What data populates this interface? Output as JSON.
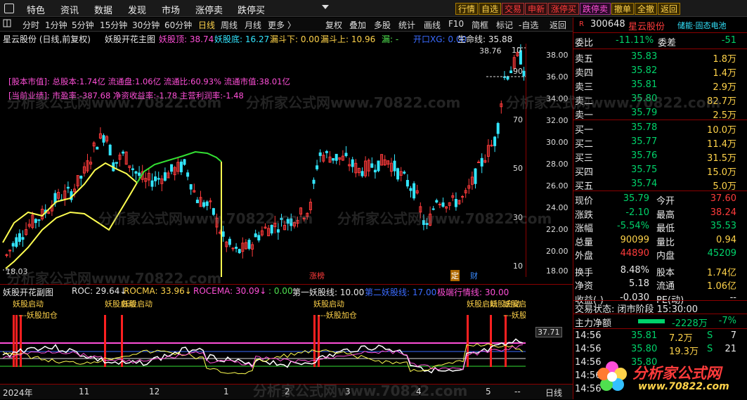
{
  "menu": [
    "特色",
    "资讯",
    "数据",
    "发现",
    "市场",
    "涨停卖",
    "跌停买"
  ],
  "toolbar_buttons": [
    {
      "label": "行情",
      "style": "yellow"
    },
    {
      "label": "自选",
      "style": "yellow"
    },
    {
      "label": "交易",
      "style": "red"
    },
    {
      "label": "申新",
      "style": "red"
    },
    {
      "label": "涨停买",
      "style": "red"
    },
    {
      "label": "跌停卖",
      "style": "mag"
    },
    {
      "label": "撤单",
      "style": "yellow"
    },
    {
      "label": "全撤",
      "style": "yellow"
    },
    {
      "label": "返回",
      "style": "yellow"
    }
  ],
  "period_tabs": [
    "分时",
    "1分钟",
    "5分钟",
    "15分钟",
    "30分钟",
    "60分钟",
    "日线",
    "周线",
    "月线",
    "更多 〉"
  ],
  "active_tab": "日线",
  "tools": [
    "复权",
    "叠加",
    "多股",
    "统计",
    "画线",
    "F10",
    "简框",
    "标记",
    "-自选",
    "返回"
  ],
  "main_indicator": {
    "stock_label": "星云股份 (日线,前复权)",
    "name": "妖股开花主图",
    "params": [
      "妖股顶: 38.74",
      "妖股底: 16.27",
      "漏斗下: 0.00",
      "漏斗上: 10.96",
      "漏: -",
      "开口XG: 0.00",
      "生命线: 35.88"
    ]
  },
  "info_box": {
    "line1": "[股本市值]:   总股本:1.74亿  流通盘:1.06亿  流通比:60.93%  流通市值:38.01亿",
    "line2": "[当前业绩]:   市盈率:-387.68  净资收益率:-1.78  主营利润率:-1.48"
  },
  "price_axis": [
    "38.00",
    "36.00",
    "34.00",
    "32.00",
    "30.00",
    "28.00",
    "26.00",
    "24.00",
    "22.00",
    "20.00",
    "18.00"
  ],
  "inner_axis": [
    "10",
    "90",
    "70",
    "50",
    "30",
    "10"
  ],
  "price_marks": {
    "high": "38.76",
    "low": "18.03"
  },
  "event_labels": [
    "涨榜",
    "定",
    "财"
  ],
  "sub_indicator": {
    "name": "妖股开花副图",
    "params": [
      "ROC: 29.64↓",
      "ROCMA: 33.96↓",
      "ROCEMA: 30.09↓",
      ": 0.00",
      "第一妖股线: 10.00",
      "第二妖股线: 17.00",
      "极端行情线: 30.00"
    ]
  },
  "sub_labels": [
    "妖股启动",
    "---妖股加仓",
    "妖股启动",
    "妖股启动",
    "妖股启动",
    "---妖股加仓",
    "妖股启动",
    "妖股启动",
    "妖股启动",
    "---妖股加"
  ],
  "sub_axis_value": "37.71",
  "dates": [
    "2024年",
    "11",
    "12",
    "1",
    "2",
    "3",
    "4",
    "5",
    "--",
    "日线"
  ],
  "quote": {
    "code": "300648",
    "name": "星云股份",
    "tags": "储能·固态电池",
    "weibi_label": "委比",
    "weibi": "-11.11%",
    "weicha_label": "委差",
    "weicha": "-51",
    "asks": [
      {
        "label": "卖五",
        "price": "35.83",
        "vol": "1.8万"
      },
      {
        "label": "卖四",
        "price": "35.82",
        "vol": "1.4万"
      },
      {
        "label": "卖三",
        "price": "35.81",
        "vol": "2.9万"
      },
      {
        "label": "卖二",
        "price": "35.80",
        "vol": "82.7万"
      },
      {
        "label": "卖一",
        "price": "35.79",
        "vol": "2.5万"
      }
    ],
    "bids": [
      {
        "label": "买一",
        "price": "35.78",
        "vol": "10.0万"
      },
      {
        "label": "买二",
        "price": "35.77",
        "vol": "11.4万"
      },
      {
        "label": "买三",
        "price": "35.76",
        "vol": "31.5万"
      },
      {
        "label": "买四",
        "price": "35.75",
        "vol": "15.0万"
      },
      {
        "label": "买五",
        "price": "35.74",
        "vol": "5.0万"
      }
    ],
    "stats": [
      {
        "l1": "现价",
        "v1": "35.79",
        "l2": "今开",
        "v2": "37.60"
      },
      {
        "l1": "涨跌",
        "v1": "-2.10",
        "l2": "最高",
        "v2": "38.24"
      },
      {
        "l1": "涨幅",
        "v1": "-5.54%",
        "l2": "最低",
        "v2": "35.53"
      },
      {
        "l1": "总量",
        "v1": "90099",
        "l2": "量比",
        "v2": "0.94"
      },
      {
        "l1": "外盘",
        "v1": "44890",
        "l2": "内盘",
        "v2": "45209"
      },
      {
        "l1": "换手",
        "v1": "8.48%",
        "l2": "股本",
        "v2": "1.74亿"
      },
      {
        "l1": "净资",
        "v1": "5.18",
        "l2": "流通",
        "v2": "1.06亿"
      },
      {
        "l1": "收益(-)",
        "v1": "-0.030",
        "l2": "PE(动)",
        "v2": "--"
      }
    ],
    "status": "交易状态: 闭市阶段 15:30:00",
    "netflow_label": "主力净额",
    "netflow": "-2228万",
    "netflow_pct": "-7%",
    "ticks": [
      {
        "time": "14:56",
        "price": "35.81",
        "vol": "7.2万",
        "side": "S",
        "n": "7"
      },
      {
        "time": "14:56",
        "price": "35.80",
        "vol": "19.3万",
        "side": "S",
        "n": "21"
      },
      {
        "time": "14:56",
        "price": "35.80",
        "vol": "",
        "side": "",
        "n": ""
      },
      {
        "time": "14:56",
        "price": "",
        "vol": "",
        "side": "",
        "n": ""
      },
      {
        "time": "14:56",
        "price": "",
        "vol": "",
        "side": "",
        "n": ""
      }
    ]
  },
  "brand": {
    "name": "分析家公式网",
    "url": "www.70822.com"
  },
  "watermark": "分析家公式网www.70822.com"
}
